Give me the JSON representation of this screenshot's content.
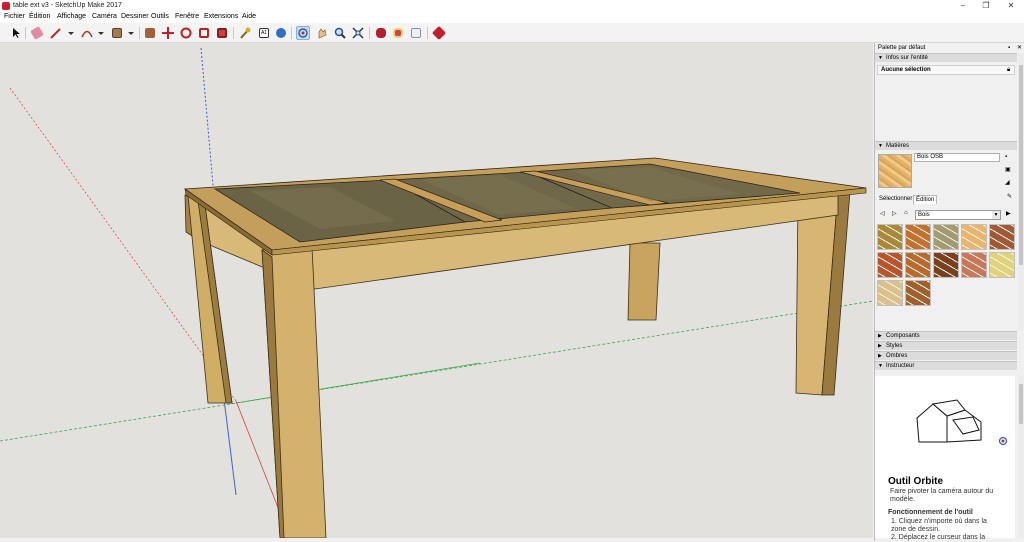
{
  "window": {
    "title": "table ext v3 - SketchUp Make 2017"
  },
  "menu": [
    "Fichier",
    "Édition",
    "Affichage",
    "Caméra",
    "Dessiner",
    "Outils",
    "Fenêtre",
    "Extensions",
    "Aide"
  ],
  "toolbar": {
    "tools": [
      "select-tool",
      "eraser-tool",
      "pencil-tool",
      "arc-tool",
      "shape-tool",
      "pushpull-tool",
      "move-tool",
      "rotate-tool",
      "offset-tool",
      "scale-tool",
      "tape-measure-tool",
      "text-tool",
      "paint-bucket-tool",
      "orbit-tool",
      "pan-tool",
      "zoom-tool",
      "zoom-extents-tool",
      "3d-warehouse-tool",
      "extension-warehouse-tool",
      "layout-tool",
      "ruby-tool"
    ],
    "active_tool": "orbit-tool"
  },
  "panel": {
    "title": "Palette par défaut",
    "entity_info": {
      "header": "Infos sur l'entité",
      "selection": "Aucune sélection"
    },
    "materials": {
      "header": "Matières",
      "current_name": "Bois OSB",
      "tabs": [
        "Sélectionner",
        "Édition"
      ],
      "category": "Bois",
      "swatches": [
        "#a88938",
        "#c3722e",
        "#a39a6d",
        "#e8b56c",
        "#9f5a35",
        "#b6562a",
        "#b76b2c",
        "#7a3f1d",
        "#c8785a",
        "#e0d37a",
        "#dcc08a",
        "#a0602c"
      ]
    },
    "sections": [
      "Composants",
      "Styles",
      "Ombres"
    ],
    "instructor": {
      "header": "Instructeur",
      "tool_name": "Outil Orbite",
      "description": "Faire pivoter la caméra autour du modèle.",
      "howto_title": "Fonctionnement de l'outil",
      "steps": [
        "1.  Cliquez n'importe où dans la",
        "     zone de dessin.",
        "2.  Déplacez le curseur dans la"
      ]
    }
  },
  "colors": {
    "viewport_bg": "#e2e1dd",
    "wood_light": "#d8b978",
    "wood_mid": "#c8a45e",
    "glass": "#6b6346",
    "axis_blue": "#3f5fd0",
    "axis_green": "#3fa84f",
    "axis_red": "#d84040"
  }
}
